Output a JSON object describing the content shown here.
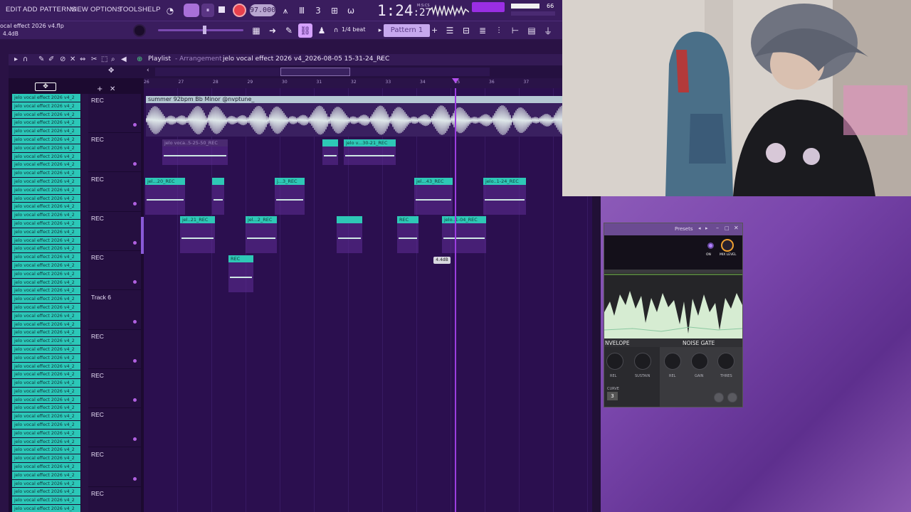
{
  "menu": [
    "EDIT",
    "ADD",
    "PATTERNS",
    "VIEW",
    "OPTIONS",
    "TOOLS",
    "HELP"
  ],
  "transport": {
    "tempo": "97.000",
    "time_main": "1:24",
    "time_sub": ":27",
    "mscs": "M:S:CS",
    "meter_value": "66"
  },
  "project": {
    "name": "ocal effect 2026 v4.flp",
    "volume": "4.4dB"
  },
  "toolbar2": {
    "snap": "1/4 beat",
    "pattern": "Pattern 1",
    "pattern_add": "+"
  },
  "playlist": {
    "title": "Playlist",
    "subtitle": "- Arrangement",
    "file": "jelo vocal effect 2026 v4_2026-08-05 15-31-24_REC",
    "ruler": [
      "26",
      "27",
      "28",
      "29",
      "30",
      "31",
      "32",
      "33",
      "34",
      "35",
      "36",
      "37"
    ],
    "browser_item": "jelo vocal effect 2026 v4_2",
    "browser_count": 50,
    "tracks": [
      "REC",
      "REC",
      "REC",
      "REC",
      "REC",
      "Track 6",
      "REC",
      "REC",
      "REC",
      "REC",
      "REC"
    ],
    "main_clip": "summer 92bpm Bb Minor @nvptune_",
    "db_tooltip": "4.4dB",
    "clips": [
      {
        "label": "jelo voca..5-25-50_REC",
        "ghost": true
      },
      {
        "label": "",
        "ghost": false
      },
      {
        "label": "jelo v...30-21_REC",
        "ghost": false
      },
      {
        "label": "jel...20_REC",
        "ghost": false
      },
      {
        "label": "",
        "ghost": false
      },
      {
        "label": "j...3_REC",
        "ghost": false
      },
      {
        "label": "jel...43_REC",
        "ghost": false
      },
      {
        "label": "jelo..1-24_REC",
        "ghost": false
      },
      {
        "label": "jel..21_REC",
        "ghost": false
      },
      {
        "label": "jel...2_REC",
        "ghost": false
      },
      {
        "label": "",
        "ghost": false
      },
      {
        "label": "REC",
        "ghost": false
      },
      {
        "label": "jelo..1-04_REC",
        "ghost": false
      },
      {
        "label": "REC",
        "ghost": false
      }
    ]
  },
  "plugin": {
    "presets": "Presets",
    "on": "ON",
    "mix": "MIX LEVEL",
    "envelope": "NVELOPE",
    "gate": "NOISE GATE",
    "knobs": [
      "REL",
      "SUSTAIN",
      "REL",
      "GAIN",
      "THRES"
    ],
    "curve_label": "CURVE",
    "curve_value": "3"
  },
  "colors": {
    "accent": "#9b3ee0",
    "clip": "#2ec8b6",
    "record": "#e8404c"
  }
}
